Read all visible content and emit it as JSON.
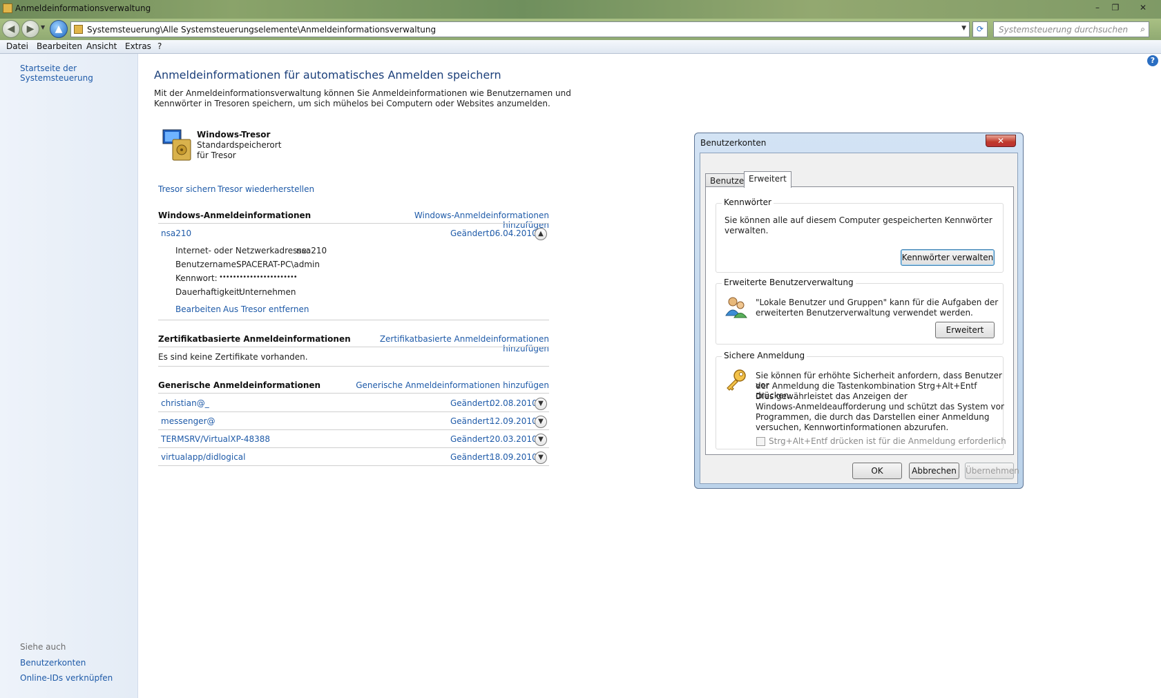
{
  "window": {
    "title": "Anmeldeinformationsverwaltung",
    "controls": {
      "minimize": "–",
      "restore": "❐",
      "close": "✕"
    }
  },
  "address": {
    "path": "Systemsteuerung\\Alle Systemsteuerungselemente\\Anmeldeinformationsverwaltung",
    "search_placeholder": "Systemsteuerung durchsuchen"
  },
  "menu": {
    "items": [
      "Datei",
      "Bearbeiten",
      "Ansicht",
      "Extras",
      "?"
    ]
  },
  "sidebar": {
    "home_link": "Startseite der Systemsteuerung",
    "see_also_label": "Siehe auch",
    "see_also": [
      "Benutzerkonten",
      "Online-IDs verknüpfen"
    ]
  },
  "main": {
    "heading": "Anmeldeinformationen für automatisches Anmelden speichern",
    "intro_line1": "Mit der Anmeldeinformationsverwaltung können Sie Anmeldeinformationen wie Benutzernamen und",
    "intro_line2": "Kennwörter in Tresoren speichern, um sich mühelos bei Computern oder Websites anzumelden.",
    "vault": {
      "title": "Windows-Tresor",
      "line1": "Standardspeicherort",
      "line2": "für Tresor"
    },
    "vault_actions": {
      "backup": "Tresor sichern",
      "restore": "Tresor wiederherstellen"
    },
    "windows_section": {
      "title": "Windows-Anmeldeinformationen",
      "add": "Windows-Anmeldeinformationen hinzufügen",
      "entry": {
        "name": "nsa210",
        "changed_label": "Geändert:",
        "changed_date": "06.04.2010",
        "address_label": "Internet- oder Netzwerkadresse:",
        "address_value": "nsa210",
        "user_label": "Benutzername:",
        "user_value": "SPACERAT-PC\\admin",
        "password_label": "Kennwort:",
        "password_value": "•••••••••••••••••••••••",
        "persistence_label": "Dauerhaftigkeit:",
        "persistence_value": "Unternehmen",
        "edit": "Bearbeiten",
        "remove": "Aus Tresor entfernen"
      }
    },
    "cert_section": {
      "title": "Zertifikatbasierte Anmeldeinformationen",
      "add": "Zertifikatbasierte Anmeldeinformationen hinzufügen",
      "empty": "Es sind keine Zertifikate vorhanden."
    },
    "generic_section": {
      "title": "Generische Anmeldeinformationen",
      "add": "Generische Anmeldeinformationen hinzufügen",
      "changed_label": "Geändert:",
      "entries": [
        {
          "name": "christian@_",
          "date": "02.08.2010"
        },
        {
          "name": "messenger@",
          "date": "12.09.2010"
        },
        {
          "name": "TERMSRV/VirtualXP-48388",
          "date": "20.03.2010"
        },
        {
          "name": "virtualapp/didlogical",
          "date": "18.09.2010"
        }
      ]
    }
  },
  "dialog": {
    "title": "Benutzerkonten",
    "close": "✕",
    "tabs": [
      "Benutzer",
      "Erweitert"
    ],
    "passwords": {
      "label": "Kennwörter",
      "text_line1": "Sie können alle auf diesem Computer gespeicherten Kennwörter",
      "text_line2": "verwalten.",
      "button": "Kennwörter verwalten"
    },
    "advanced": {
      "label": "Erweiterte Benutzerverwaltung",
      "text_line1": "\"Lokale Benutzer und Gruppen\" kann für die Aufgaben der",
      "text_line2": "erweiterten Benutzerverwaltung verwendet werden.",
      "button": "Erweitert"
    },
    "secure": {
      "label": "Sichere Anmeldung",
      "lines": [
        "Sie können für erhöhte Sicherheit anfordern, dass Benutzer vor",
        "der Anmeldung die Tastenkombination Strg+Alt+Entf drücken.",
        "Dies gewährleistet das Anzeigen der",
        "Windows-Anmeldeaufforderung und schützt das System vor",
        "Programmen, die durch das Darstellen einer Anmeldung",
        "versuchen, Kennwortinformationen abzurufen."
      ],
      "checkbox": "Strg+Alt+Entf drücken ist für die Anmeldung erforderlich"
    },
    "buttons": {
      "ok": "OK",
      "cancel": "Abbrechen",
      "apply": "Übernehmen"
    }
  }
}
